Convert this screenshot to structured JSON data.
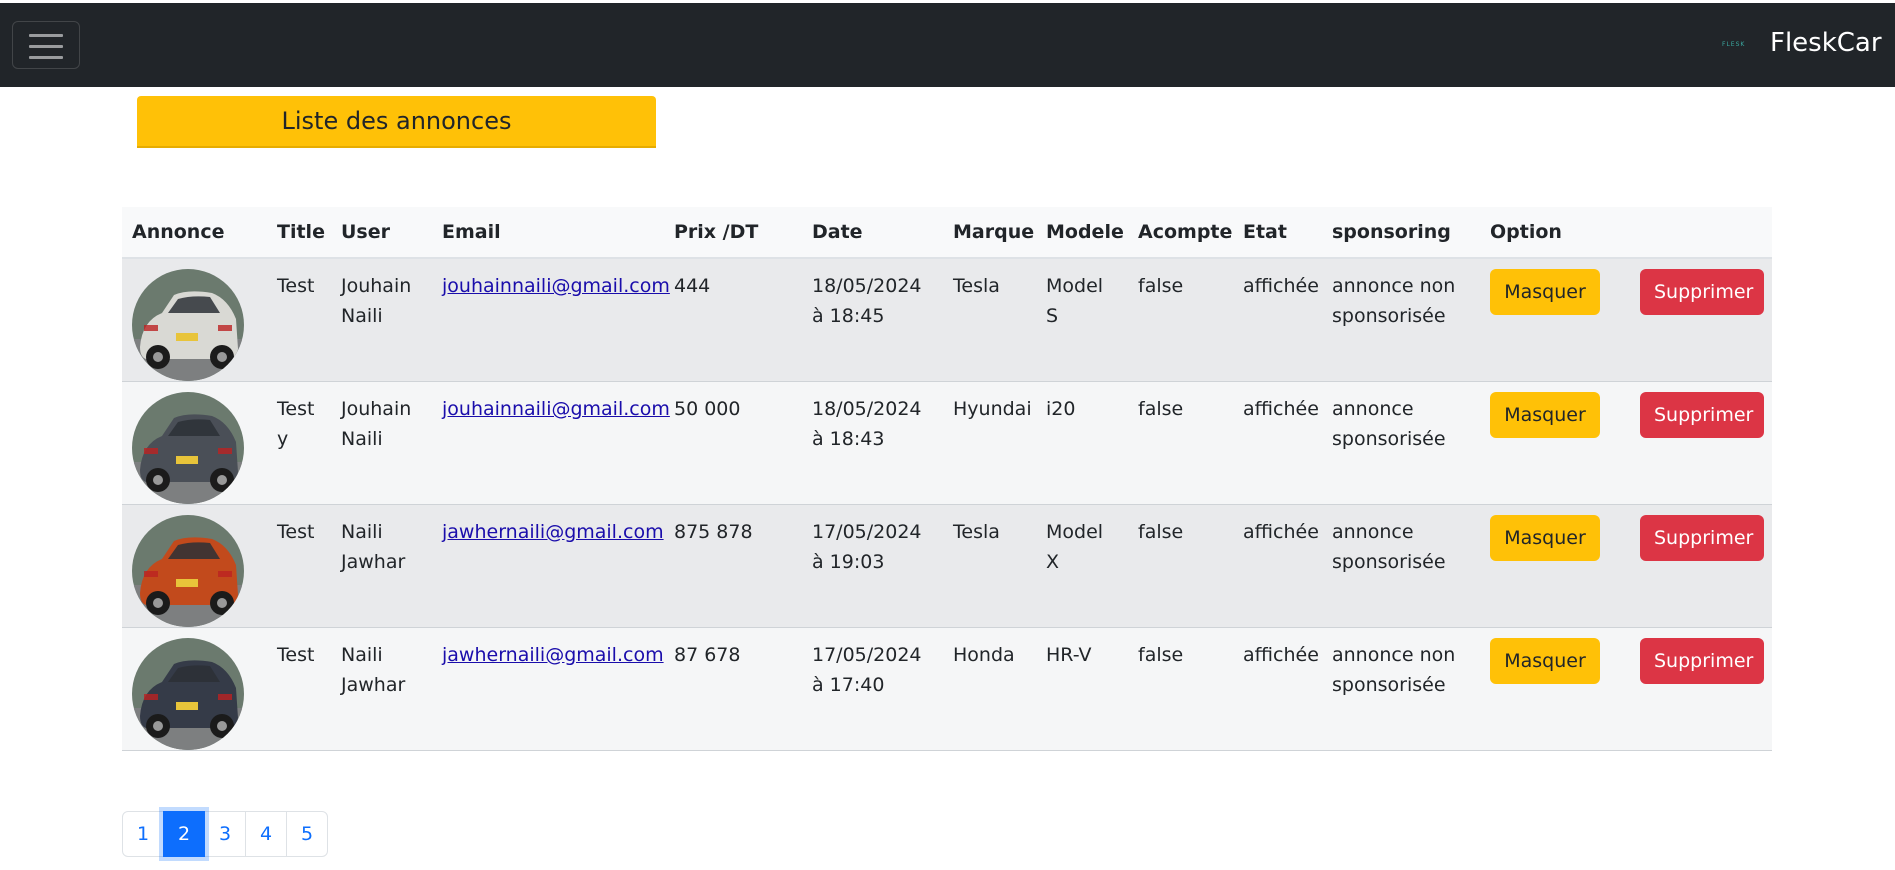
{
  "navbar": {
    "brand_logo_text": "FLESK",
    "brand_name": "FleskCar"
  },
  "page_title": "Liste des annonces",
  "table": {
    "headers": [
      "Annonce",
      "Title",
      "User",
      "Email",
      "Prix /DT",
      "Date",
      "Marque",
      "Modele",
      "Acompte",
      "Etat",
      "sponsoring",
      "Option",
      ""
    ],
    "rows": [
      {
        "car_color": "#d9d9d4",
        "title": "Test",
        "user": "Jouhain Naili",
        "email": "jouhainnaili@gmail.com",
        "prix": "444",
        "date": "18/05/2024 à 18:45",
        "marque": "Tesla",
        "modele": "Model S",
        "acompte": "false",
        "etat": "affichée",
        "sponsoring": "annonce non sponsorisée",
        "masquer": "Masquer",
        "supprimer": "Supprimer"
      },
      {
        "car_color": "#4a4f57",
        "title": "Test y",
        "user": "Jouhain Naili",
        "email": "jouhainnaili@gmail.com",
        "prix": "50 000",
        "date": "18/05/2024 à 18:43",
        "marque": "Hyundai",
        "modele": "i20",
        "acompte": "false",
        "etat": "affichée",
        "sponsoring": "annonce sponsorisée",
        "masquer": "Masquer",
        "supprimer": "Supprimer"
      },
      {
        "car_color": "#c24a1c",
        "title": "Test",
        "user": "Naili Jawhar",
        "email": "jawhernaili@gmail.com",
        "prix": "875 878",
        "date": "17/05/2024 à 19:03",
        "marque": "Tesla",
        "modele": "Model X",
        "acompte": "false",
        "etat": "affichée",
        "sponsoring": "annonce sponsorisée",
        "masquer": "Masquer",
        "supprimer": "Supprimer"
      },
      {
        "car_color": "#353b48",
        "title": "Test",
        "user": "Naili Jawhar",
        "email": "jawhernaili@gmail.com",
        "prix": "87 678",
        "date": "17/05/2024 à 17:40",
        "marque": "Honda",
        "modele": "HR-V",
        "acompte": "false",
        "etat": "affichée",
        "sponsoring": "annonce non sponsorisée",
        "masquer": "Masquer",
        "supprimer": "Supprimer"
      }
    ]
  },
  "pagination": {
    "pages": [
      "1",
      "2",
      "3",
      "4",
      "5"
    ],
    "active": "2"
  },
  "colors": {
    "navbar": "#212529",
    "warning": "#ffc107",
    "danger": "#dc3545",
    "primary": "#0d6efd"
  },
  "icons": {
    "toggler": "hamburger-menu-icon"
  }
}
